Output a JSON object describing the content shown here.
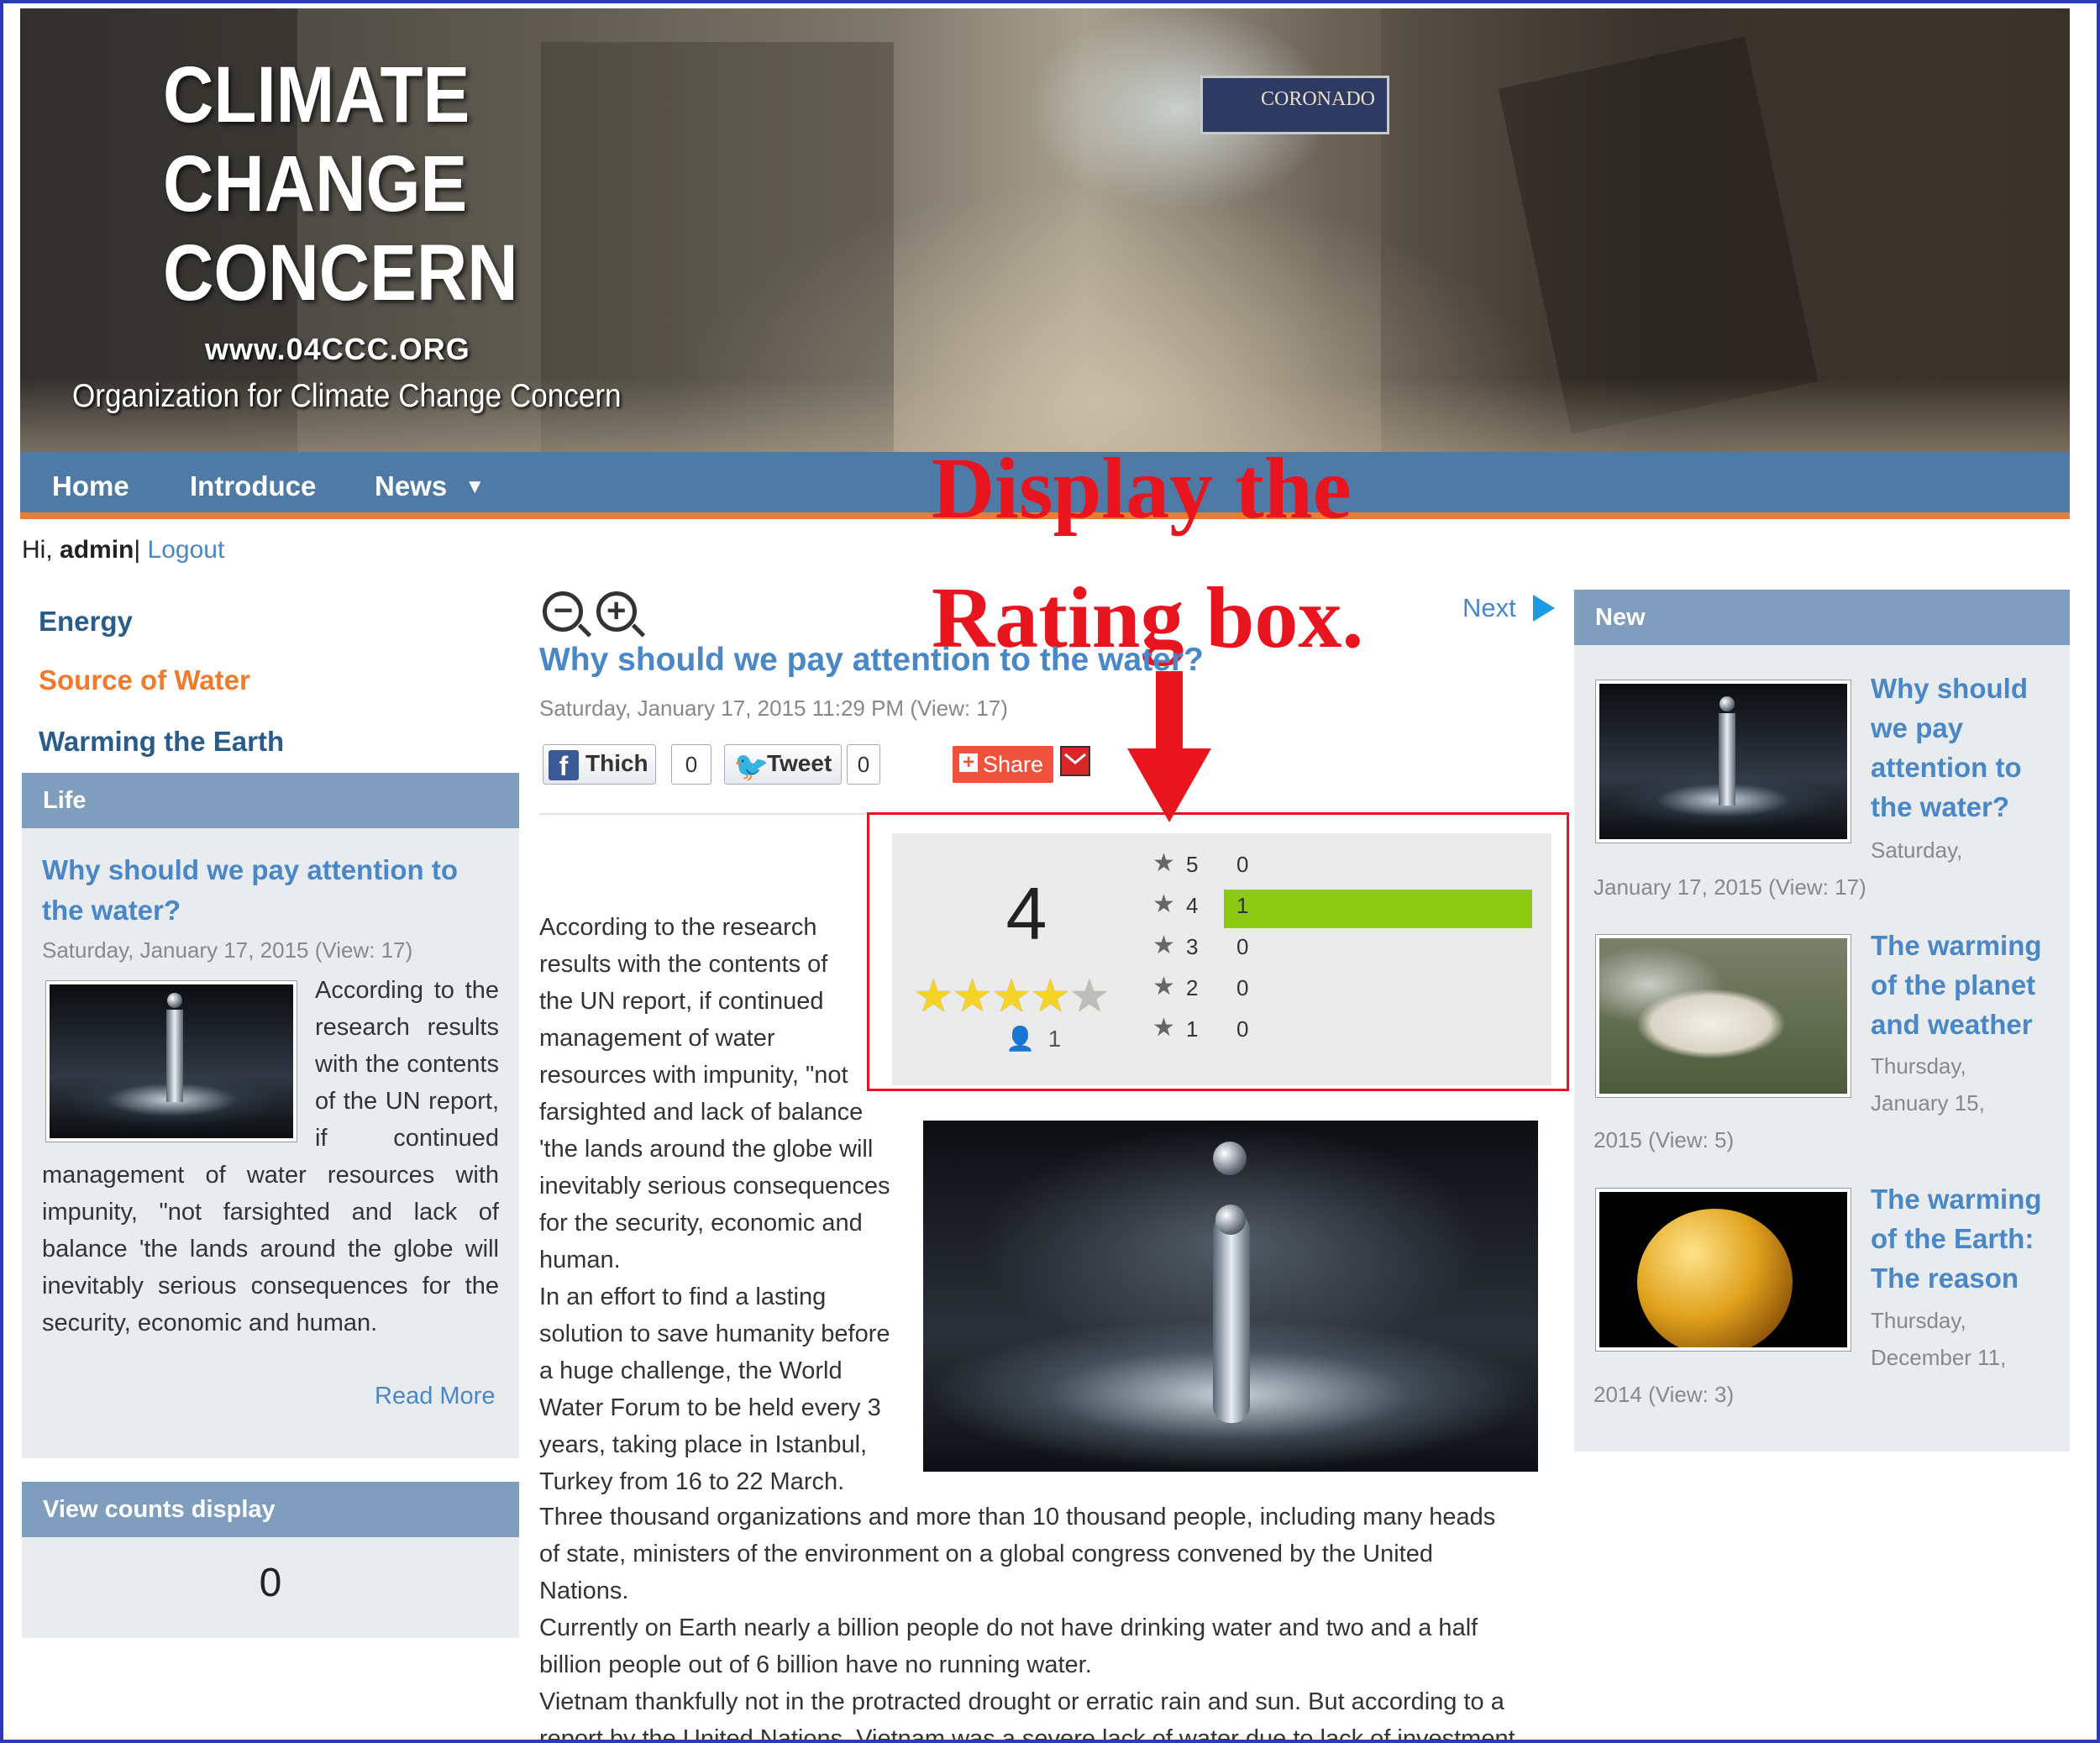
{
  "banner": {
    "title_lines": [
      "CLIMATE",
      "CHANGE",
      "CONCERN"
    ],
    "url": "www.04CCC.ORG",
    "org": "Organization for Climate Change Concern",
    "sign": "CORONADO"
  },
  "nav": {
    "items": [
      "Home",
      "Introduce",
      "News"
    ],
    "news_caret": "▼"
  },
  "annotation": {
    "line1": "Display the",
    "line2": "Rating box.",
    "color": "#e8141e"
  },
  "user": {
    "greeting": "Hi,",
    "name": "admin",
    "sep": "|",
    "logout": "Logout"
  },
  "left": {
    "categories": [
      "Energy",
      "Source of Water",
      "Warming the Earth"
    ],
    "active_category_color": "#f07b2c",
    "life": {
      "header": "Life",
      "title": "Why should we pay attention to the water?",
      "meta": "Saturday, January 17, 2015  (View: 17)",
      "excerpt": "According to the research results with the contents of the UN report, if continued management of water resources with impunity, \"not farsighted and lack of balance 'the lands around the globe will inevitably serious consequences for the security, economic and human.",
      "read_more": "Read More"
    },
    "view_counts": {
      "header": "View counts display",
      "value": "0"
    }
  },
  "article": {
    "next": "Next",
    "title": "Why should we pay attention to the water?",
    "meta": "Saturday, January 17, 2015  11:29 PM  (View: 17)",
    "social": {
      "like": "Thich",
      "like_count": "0",
      "tweet": "Tweet",
      "tweet_count": "0",
      "share": "Share"
    },
    "rating": {
      "average": "4",
      "stars": 4,
      "voters": "1",
      "rows": [
        {
          "star": "5",
          "count": "0",
          "fraction": 0
        },
        {
          "star": "4",
          "count": "1",
          "fraction": 1
        },
        {
          "star": "3",
          "count": "0",
          "fraction": 0
        },
        {
          "star": "2",
          "count": "0",
          "fraction": 0
        },
        {
          "star": "1",
          "count": "0",
          "fraction": 0
        }
      ]
    },
    "body_lines_left": [
      "According to the research",
      "results with the contents of",
      "the UN report, if continued",
      "management of water",
      "resources with impunity, \"not",
      "farsighted and lack of balance",
      "'the lands around the globe will",
      "inevitably serious consequences",
      "for the security, economic and",
      "human.",
      "In an effort to find a lasting",
      "solution to save humanity before",
      "a huge challenge, the World",
      "Water Forum to be held every 3",
      "years, taking place in Istanbul,",
      "Turkey from 16 to 22 March."
    ],
    "body_lines_full": [
      "Three thousand organizations and more than 10 thousand people, including many heads",
      "of state, ministers of the environment on a global congress convened by the United",
      "Nations.",
      "Currently on Earth nearly a billion people do not have drinking water and two and a half",
      "billion people out of 6 billion have no running water.",
      "Vietnam thankfully not in the protracted drought or erratic rain and sun. But according to a",
      "report by the United Nations, Vietnam was a severe lack of water due to lack of investment"
    ]
  },
  "right": {
    "header": "New",
    "items": [
      {
        "title_lines": [
          "Why should",
          "we pay",
          "attention to",
          "the water?"
        ],
        "date_a": "Saturday,",
        "date_b": "January 17, 2015  (View: 17)"
      },
      {
        "title_lines": [
          "The warming",
          "of the planet",
          "and weather"
        ],
        "date_a": "Thursday,",
        "date_a2": "January 15,",
        "date_b": "2015  (View: 5)"
      },
      {
        "title_lines": [
          "The warming",
          "of the Earth:",
          "The reason"
        ],
        "date_a": "Thursday,",
        "date_a2": "December 11,",
        "date_b": "2014  (View: 3)"
      }
    ]
  }
}
